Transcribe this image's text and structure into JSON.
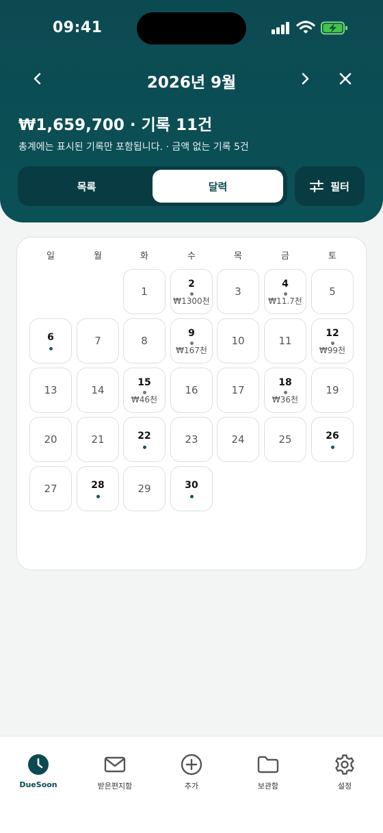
{
  "status": {
    "time": "09:41"
  },
  "header": {
    "month_title": "2026년 9월",
    "total": "₩1,659,700 · 기록 11건",
    "note": "총계에는 표시된 기록만 포함됩니다. · 금액 없는 기록 5건",
    "tabs": {
      "list": "목록",
      "calendar": "달력",
      "active": "calendar"
    },
    "filter_label": "필터"
  },
  "calendar": {
    "weekdays": [
      "일",
      "월",
      "화",
      "수",
      "목",
      "금",
      "토"
    ],
    "first_weekday_index": 2,
    "days": [
      {
        "n": "1"
      },
      {
        "n": "2",
        "has": true,
        "amount": "₩1300천"
      },
      {
        "n": "3"
      },
      {
        "n": "4",
        "has": true,
        "amount": "₩11.7천"
      },
      {
        "n": "5"
      },
      {
        "n": "6",
        "has": true
      },
      {
        "n": "7"
      },
      {
        "n": "8"
      },
      {
        "n": "9",
        "has": true,
        "amount": "₩167천"
      },
      {
        "n": "10"
      },
      {
        "n": "11"
      },
      {
        "n": "12",
        "has": true,
        "amount": "₩99천"
      },
      {
        "n": "13"
      },
      {
        "n": "14"
      },
      {
        "n": "15",
        "has": true,
        "amount": "₩46천"
      },
      {
        "n": "16"
      },
      {
        "n": "17"
      },
      {
        "n": "18",
        "has": true,
        "amount": "₩36천"
      },
      {
        "n": "19"
      },
      {
        "n": "20"
      },
      {
        "n": "21"
      },
      {
        "n": "22",
        "has": true
      },
      {
        "n": "23"
      },
      {
        "n": "24"
      },
      {
        "n": "25"
      },
      {
        "n": "26",
        "has": true
      },
      {
        "n": "27"
      },
      {
        "n": "28",
        "has": true
      },
      {
        "n": "29"
      },
      {
        "n": "30",
        "has": true
      }
    ]
  },
  "tabbar": {
    "items": [
      {
        "label": "DueSoon",
        "icon": "clock-icon",
        "active": true
      },
      {
        "label": "받은편지함",
        "icon": "mail-icon"
      },
      {
        "label": "추가",
        "icon": "plus-circle-icon"
      },
      {
        "label": "보관함",
        "icon": "folder-icon"
      },
      {
        "label": "설정",
        "icon": "gear-icon"
      }
    ]
  },
  "colors": {
    "header": "#0c4a52",
    "accent": "#0b5a63",
    "background": "#f3f5f5"
  }
}
